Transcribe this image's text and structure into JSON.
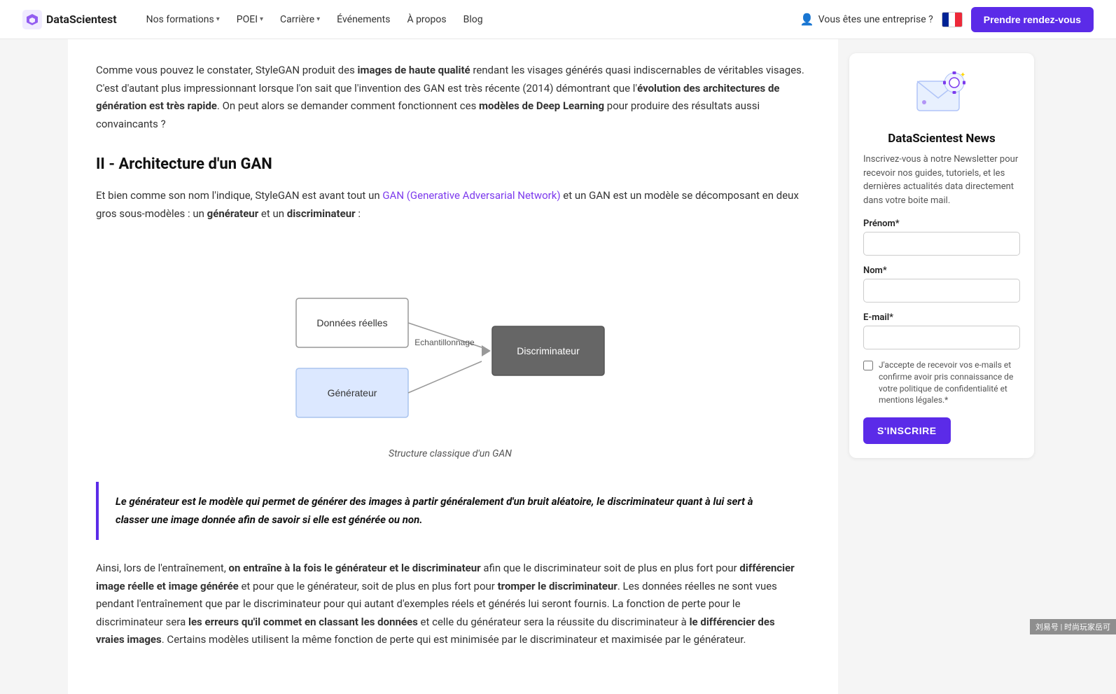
{
  "navbar": {
    "logo_text": "DataScientest",
    "nav_items": [
      {
        "label": "Nos formations",
        "has_dropdown": true
      },
      {
        "label": "POEI",
        "has_dropdown": true
      },
      {
        "label": "Carrière",
        "has_dropdown": true
      },
      {
        "label": "Événements",
        "has_dropdown": false
      },
      {
        "label": "À propos",
        "has_dropdown": false
      },
      {
        "label": "Blog",
        "has_dropdown": false
      }
    ],
    "enterprise_label": "Vous êtes une entreprise ?",
    "cta_label": "Prendre rendez-vous"
  },
  "main": {
    "intro_paragraph_1": "Comme vous pouvez le constater, StyleGAN produit des ",
    "intro_bold_1": "images de haute qualité",
    "intro_paragraph_2": " rendant les visages générés quasi indiscernables de véritables visages. C'est d'autant plus impressionnant lorsque l'on sait que l'invention des GAN est très récente (2014) démontrant que l'",
    "intro_bold_2": "évolution des architectures de génération est très rapide",
    "intro_paragraph_3": ". On peut alors se demander comment fonctionnent ces ",
    "intro_bold_3": "modèles de Deep Learning",
    "intro_paragraph_4": " pour produire des résultats aussi convaincants ?",
    "section_heading": "II - Architecture d'un GAN",
    "section_intro_1": "Et bien comme son nom l'indique, StyleGAN est avant tout un ",
    "section_link_text": "GAN (Generative Adversarial Network)",
    "section_intro_2": " et un GAN est un modèle se décomposant en deux gros sous-modèles : un ",
    "section_bold_1": "générateur",
    "section_intro_3": " et un ",
    "section_bold_2": "discriminateur",
    "section_intro_4": " :",
    "diagram": {
      "box1_label": "Données réelles",
      "box2_label": "Générateur",
      "arrow_label": "Echantillonnage",
      "box3_label": "Discriminateur",
      "caption": "Structure classique d'un GAN"
    },
    "highlight_text": "Le générateur est le modèle qui permet de générer des images à partir généralement d'un bruit aléatoire, le discriminateur quant à lui sert à classer une image donnée afin de savoir si elle est générée ou non.",
    "body_para1_1": "Ainsi, lors de l'entraînement, ",
    "body_para1_bold": "on entraîne à la fois le générateur et le discriminateur",
    "body_para1_2": " afin que le discriminateur soit de plus en plus fort pour ",
    "body_para1_bold2": "différencier image réelle et image générée",
    "body_para1_3": " et pour que le générateur, soit de plus en plus fort pour ",
    "body_para1_bold3": "tromper le discriminateur",
    "body_para1_4": ". Les données réelles ne sont vues pendant l'entraînement que par le discriminateur pour qui autant d'exemples réels et générés lui seront fournis. La fonction de perte pour le discriminateur sera ",
    "body_para1_bold4": "les erreurs qu'il commet en classant les données",
    "body_para1_5": " et celle du générateur sera la réussite du discriminateur à ",
    "body_para1_bold5": "le différencier des vraies images",
    "body_para1_6": ". Certains modèles utilisent la même fonction de perte qui est minimisée par le discriminateur et maximisée par le générateur."
  },
  "sidebar": {
    "newsletter_title": "DataScientest News",
    "newsletter_desc": "Inscrivez-vous à notre Newsletter pour recevoir nos guides, tutoriels, et les dernières actualités data directement dans votre boite mail.",
    "prenom_label": "Prénom*",
    "nom_label": "Nom*",
    "email_label": "E-mail*",
    "consent_text": "J'accepte de recevoir vos e-mails et confirme avoir pris connaissance de votre politique de confidentialité et mentions légales.*",
    "submit_label": "S'INSCRIRE"
  },
  "bottom_branding": "刘易号 | 时尚玩家岳可"
}
